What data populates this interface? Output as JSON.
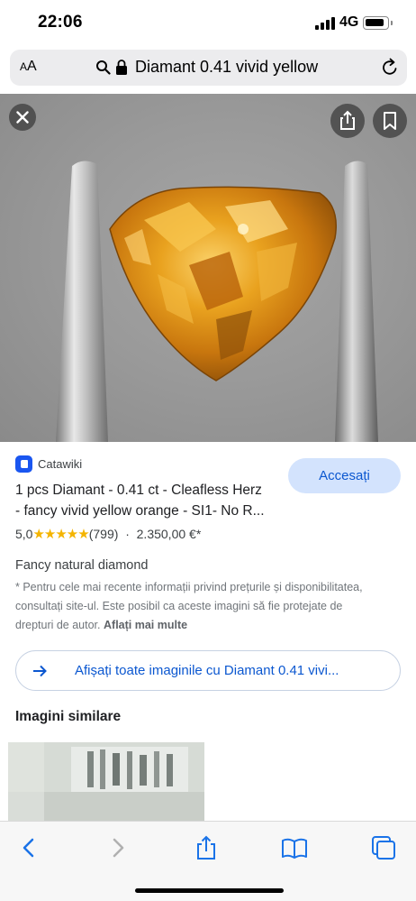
{
  "status": {
    "time": "22:06",
    "network": "4G",
    "battery_level": 0.85
  },
  "address_bar": {
    "text_size_label_small": "A",
    "text_size_label_large": "A",
    "query": "Diamant 0.41 vivid yellow"
  },
  "result": {
    "source": "Catawiki",
    "visit_label": "Accesați",
    "title_line1": "1 pcs Diamant - 0.41 ct - Cleafless Herz",
    "title_line2": "- fancy vivid yellow orange - SI1- No R...",
    "rating_value": "5,0",
    "stars": "★★★★★",
    "rating_count": "(799)",
    "separator": "·",
    "price": "2.350,00 €*",
    "description": "Fancy natural diamond",
    "note_line1": "* Pentru cele mai recente informații privind prețurile și disponibilitatea,",
    "note_line2": "consultați site-ul. Este posibil ca aceste imagini să fie protejate de",
    "note_line3": "drepturi de autor.",
    "learn_more": "Aflați mai multe",
    "all_images_label": "Afișați toate imaginile cu Diamant 0.41 vivi...",
    "similar_heading": "Imagini similare"
  },
  "colors": {
    "accent_blue": "#0b57d0",
    "button_bg": "#d3e3fd",
    "star": "#f4b400",
    "catawiki": "#1a56f0"
  },
  "icons": [
    "close-icon",
    "share-icon",
    "bookmark-icon",
    "search-icon",
    "lock-icon",
    "reload-icon",
    "arrow-right-icon",
    "back-icon",
    "forward-icon",
    "book-icon",
    "tabs-icon"
  ]
}
